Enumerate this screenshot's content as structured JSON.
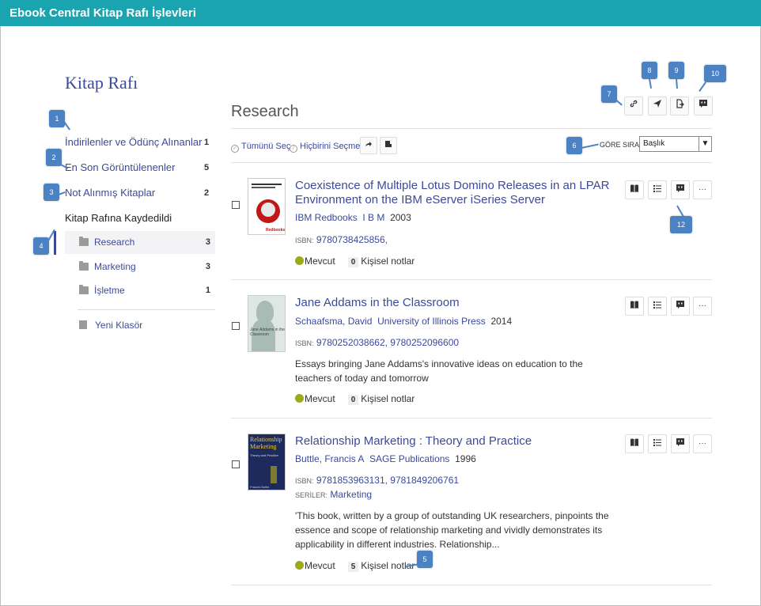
{
  "window": {
    "title": "Ebook Central Kitap Rafı İşlevleri"
  },
  "sidebar": {
    "title": "Kitap Rafı",
    "items": [
      {
        "label": "İndirilenler ve Ödünç Alınanlar",
        "count": "1"
      },
      {
        "label": "En Son Görüntülenenler",
        "count": "5"
      },
      {
        "label": "Not Alınmış Kitaplar",
        "count": "2"
      }
    ],
    "saved_label": "Kitap Rafına Kaydedildi",
    "folders": [
      {
        "label": "Research",
        "count": "3"
      },
      {
        "label": "Marketing",
        "count": "3"
      },
      {
        "label": "İşletme",
        "count": "1"
      }
    ],
    "new_folder": "Yeni Klasör"
  },
  "main": {
    "title": "Research",
    "select_all": "Tümünü Seç",
    "select_none": "Hiçbirini Seçme",
    "sort_label": "GÖRE SIRALA",
    "sort_value": "Başlık"
  },
  "results": [
    {
      "title": "Coexistence of Multiple Lotus Domino Releases in an LPAR Environment on the IBM eServer iSeries Server",
      "author": "IBM Redbooks",
      "publisher": "I B M",
      "year": "2003",
      "isbn_label": "ISBN:",
      "isbn": "9780738425856,",
      "availability": "Mevcut",
      "notes_count": "0",
      "notes_label": "Kişisel notlar"
    },
    {
      "title": "Jane Addams in the Classroom",
      "author": "Schaafsma, David",
      "publisher": "University of Illinois Press",
      "year": "2014",
      "isbn_label": "ISBN:",
      "isbn": "9780252038662, 9780252096600",
      "description": "Essays bringing Jane Addams's innovative ideas on education to the teachers of today and tomorrow",
      "availability": "Mevcut",
      "notes_count": "0",
      "notes_label": "Kişisel notlar"
    },
    {
      "title": "Relationship Marketing : Theory and Practice",
      "author": "Buttle, Francis A",
      "publisher": "SAGE Publications",
      "year": "1996",
      "isbn_label": "ISBN:",
      "isbn": "9781853963131, 9781849206761",
      "series_label": "SERİLER:",
      "series": "Marketing",
      "description": "'This book, written by a group of outstanding UK researchers, pinpoints the essence and scope of relationship marketing and vividly demonstrates its applicability in different industries. Relationship...",
      "availability": "Mevcut",
      "notes_count": "5",
      "notes_label": "Kişisel notlar"
    }
  ],
  "covers": [
    {
      "text": "Redbooks"
    },
    {
      "text": "Jane Addams in the Classroom"
    },
    {
      "title": "Relationship Marketing",
      "subtitle": "Theory and Practice",
      "author": "Francis Buttle"
    }
  ],
  "callouts": [
    "1",
    "2",
    "3",
    "4",
    "5",
    "6",
    "7",
    "8",
    "9",
    "10",
    "12"
  ],
  "icons": {
    "link": "link-icon",
    "send": "send-icon",
    "export": "export-icon",
    "comment": "comment-icon",
    "share": "share-icon",
    "print": "print-icon",
    "read": "book-open-icon",
    "toc": "list-icon",
    "more": "ellipsis-icon"
  },
  "colors": {
    "header": "#1aa4b0",
    "link": "#3b4a9b",
    "callout": "#4a82c4",
    "available": "#9aaa1a"
  }
}
